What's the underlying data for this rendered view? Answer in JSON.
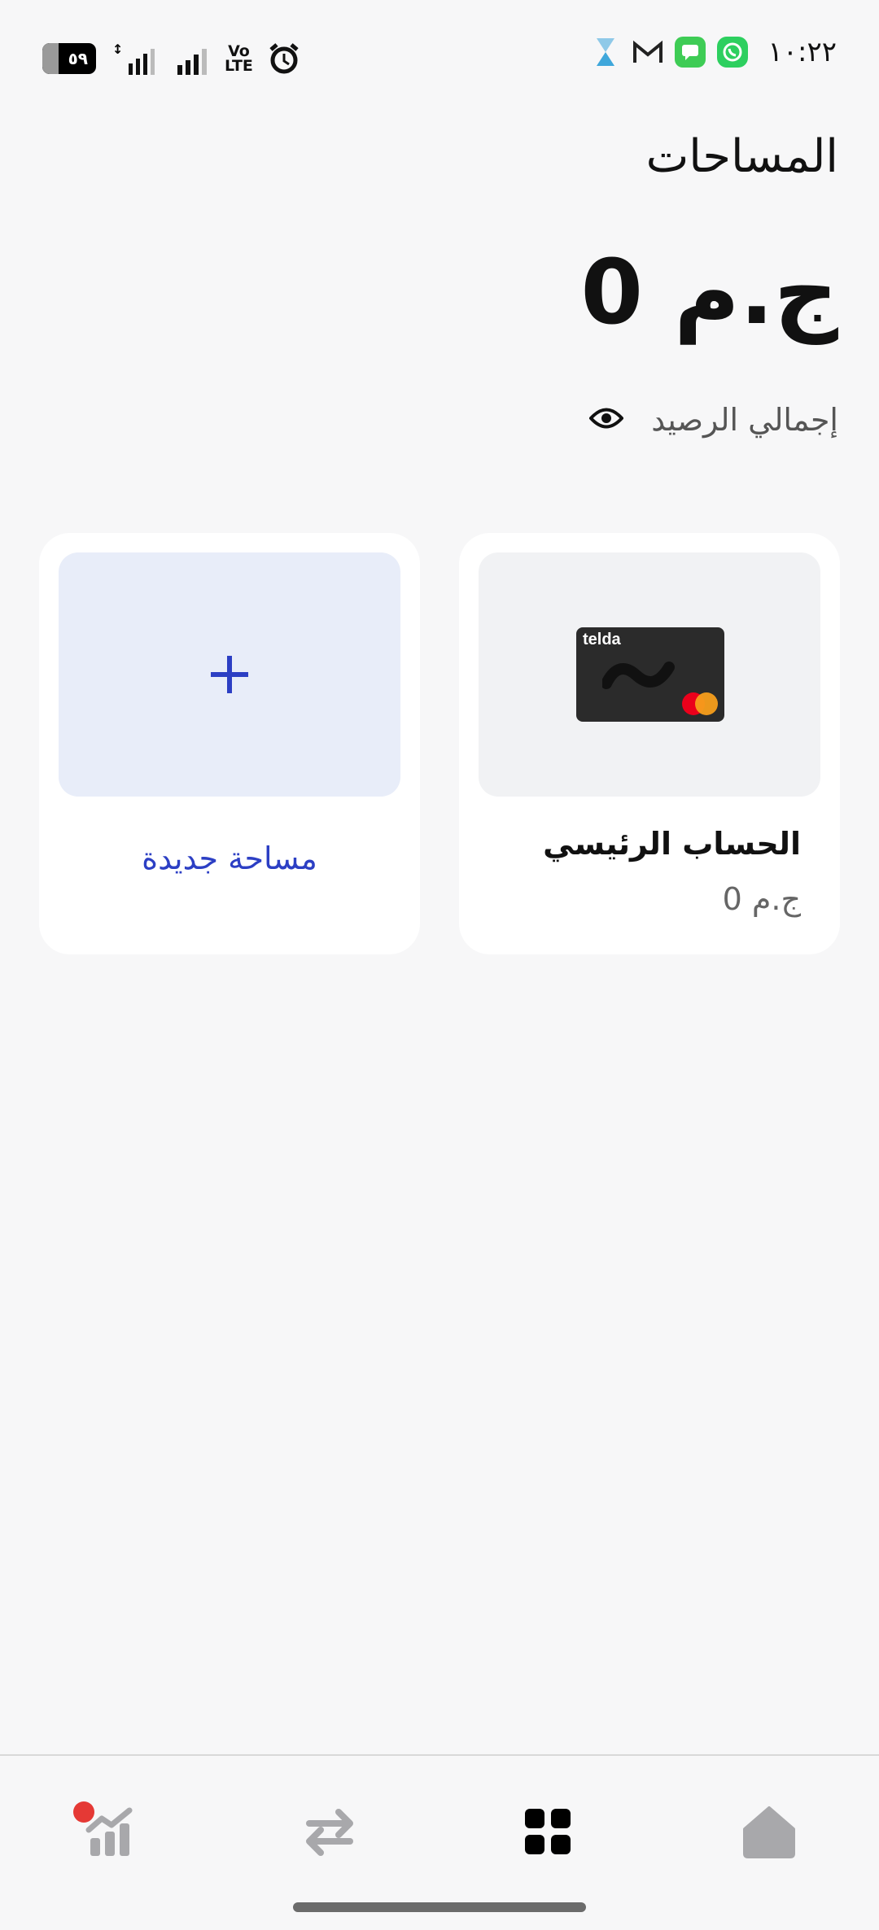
{
  "status_bar": {
    "battery": "٥٩",
    "network": "4G+",
    "volte_top": "Vo",
    "volte_bottom": "LTE",
    "time": "١٠:٢٢"
  },
  "header": {
    "title": "المساحات",
    "total_balance": "ج.م 0",
    "balance_label": "إجمالي الرصيد"
  },
  "spaces": [
    {
      "name": "الحساب الرئيسي",
      "balance": "ج.م 0",
      "card_brand": "telda"
    }
  ],
  "new_space": {
    "label": "مساحة جديدة"
  },
  "nav": {
    "items": [
      "stats",
      "transfer",
      "spaces",
      "home"
    ],
    "active": "spaces",
    "active_color": "#000000",
    "inactive_color": "#a8a8ab",
    "notification_color": "#e53935"
  },
  "colors": {
    "accent": "#2c3fc4",
    "new_space_bg": "#e8edf9"
  }
}
